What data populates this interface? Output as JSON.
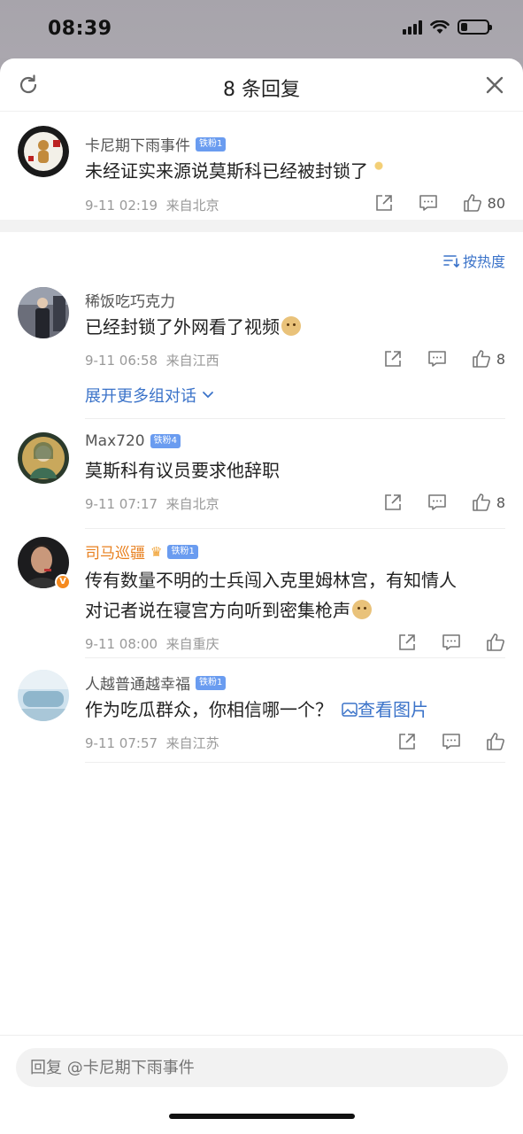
{
  "status_bar": {
    "time": "08:39",
    "battery_level": 0.25
  },
  "header": {
    "title": "8 条回复"
  },
  "colors": {
    "link_blue": "#3b73c9",
    "fan_badge": "#6a9cf0",
    "orange_name": "#e8801f",
    "meta_gray": "#999999"
  },
  "main_comment": {
    "username": "卡尼期下雨事件",
    "fan_badge": "铁粉1",
    "text": "未经证实来源说莫斯科已经被封锁了",
    "time": "9-11 02:19",
    "location": "来自北京",
    "likes": "80"
  },
  "sort": {
    "label": "按热度"
  },
  "replies": [
    {
      "username": "稀饭吃巧克力",
      "fan_badge": "",
      "text": "已经封锁了外网看了视频",
      "time": "9-11 06:58",
      "location": "来自江西",
      "likes": "8",
      "expand": "展开更多组对话"
    },
    {
      "username": "Max720",
      "fan_badge": "铁粉4",
      "text": "莫斯科有议员要求他辞职",
      "time": "9-11 07:17",
      "location": "来自北京",
      "likes": "8"
    },
    {
      "username": "司马巡疆",
      "fan_badge": "铁粉1",
      "text_line1": "传有数量不明的士兵闯入克里姆林宫，有知情人",
      "text_line2": "对记者说在寝宫方向听到密集枪声",
      "time": "9-11 08:00",
      "location": "来自重庆",
      "likes": ""
    },
    {
      "username": "人越普通越幸福",
      "fan_badge": "铁粉1",
      "text": "作为吃瓜群众，你相信哪一个？",
      "view_image": "查看图片",
      "time": "9-11 07:57",
      "location": "来自江苏",
      "likes": ""
    }
  ],
  "reply_bar": {
    "placeholder": "回复 @卡尼期下雨事件"
  },
  "icons": [
    "refresh-icon",
    "close-icon",
    "share-icon",
    "comment-icon",
    "like-icon",
    "sort-icon",
    "chevron-down-icon",
    "image-icon",
    "verified-icon",
    "crown-icon"
  ]
}
